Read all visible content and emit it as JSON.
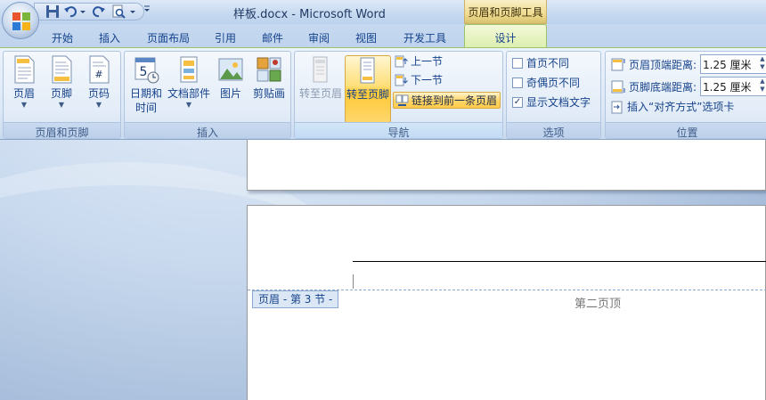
{
  "window": {
    "title": "样板.docx - Microsoft Word",
    "context_tab_group": "页眉和页脚工具"
  },
  "qat": {
    "icons": [
      "save-icon",
      "undo-icon",
      "redo-icon",
      "print-preview-icon",
      "customize-qat-icon"
    ]
  },
  "tabs": [
    {
      "label": "开始"
    },
    {
      "label": "插入"
    },
    {
      "label": "页面布局"
    },
    {
      "label": "引用"
    },
    {
      "label": "邮件"
    },
    {
      "label": "审阅"
    },
    {
      "label": "视图"
    },
    {
      "label": "开发工具"
    },
    {
      "label": "设计",
      "active": true
    }
  ],
  "ribbon": {
    "header_footer": {
      "label": "页眉和页脚",
      "header": "页眉",
      "footer": "页脚",
      "page_number": "页码"
    },
    "insert": {
      "label": "插入",
      "date_time_line1": "日期和",
      "date_time_line2": "时间",
      "quick_parts": "文档部件",
      "picture": "图片",
      "clip_art": "剪贴画",
      "calendar_number": "5"
    },
    "navigation": {
      "label": "导航",
      "go_to_header": "转至页眉",
      "go_to_footer": "转至页脚",
      "previous_section": "上一节",
      "next_section": "下一节",
      "link_to_previous": "链接到前一条页眉"
    },
    "options": {
      "label": "选项",
      "different_first_page": {
        "label": "首页不同",
        "checked": false
      },
      "different_odd_even": {
        "label": "奇偶页不同",
        "checked": false
      },
      "show_document_text": {
        "label": "显示文档文字",
        "checked": true,
        "mark": "✓"
      }
    },
    "position": {
      "label": "位置",
      "header_from_top_label": "页眉顶端距离:",
      "header_from_top_value": "1.25 厘米",
      "footer_from_bottom_label": "页脚底端距离:",
      "footer_from_bottom_value": "1.25 厘米",
      "insert_alignment_tab": "插入“对齐方式”选项卡"
    }
  },
  "document": {
    "header_tag": "页眉 - 第 3 节 -",
    "header_text": "第二页顶"
  },
  "colors": {
    "ribbon_text": "#15428b",
    "active_tab": "#dcefae",
    "highlight": "#ffd66e"
  }
}
